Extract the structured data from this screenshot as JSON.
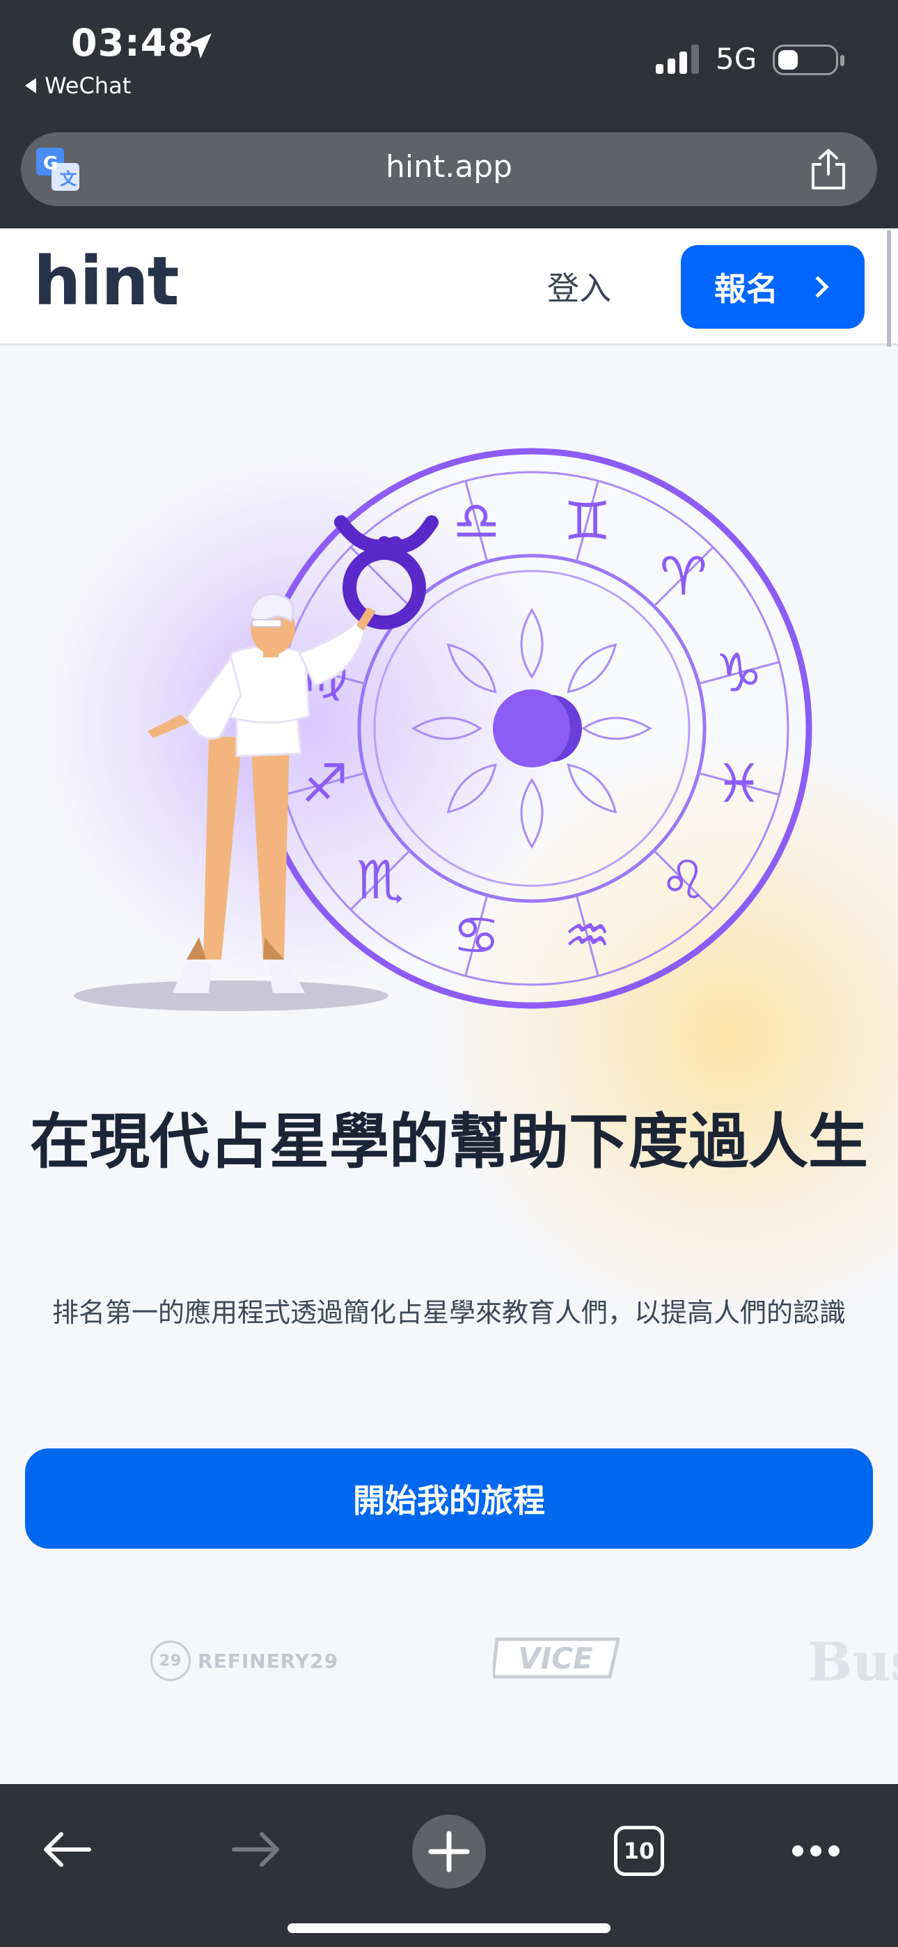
{
  "status_bar": {
    "time": "03:48",
    "back_app": "WeChat",
    "network": "5G",
    "battery_level": 0.35
  },
  "browser": {
    "url": "hint.app",
    "open_tabs": "10"
  },
  "header": {
    "logo": "hint",
    "login_label": "登入",
    "signup_label": "報名"
  },
  "hero": {
    "headline": "在現代占星學的幫助下度過人生",
    "subline": "排名第一的應用程式透過簡化占星學來教育人們，以提高人們的認識",
    "cta_label": "開始我的旅程"
  },
  "press": {
    "refinery_mark": "29",
    "refinery_label": "REFINERY29",
    "vice_label": "VICE",
    "bus_label": "Bus"
  },
  "zodiac_glyphs": [
    "♎",
    "♊",
    "♈",
    "♑",
    "♓",
    "♌",
    "♒",
    "♋",
    "♏",
    "♐",
    "♍",
    "♉"
  ],
  "colors": {
    "accent": "#0066ff",
    "cta": "#0068ee",
    "wheel": "#8b5cf6",
    "chrome": "#2f3236",
    "text_dark": "#1b2536"
  },
  "icons": {
    "location": "location-arrow-icon",
    "translate": "translate-icon",
    "share": "share-icon",
    "back": "back-arrow-icon",
    "forward": "forward-arrow-icon",
    "new_tab": "plus-icon",
    "more": "more-dots-icon"
  }
}
